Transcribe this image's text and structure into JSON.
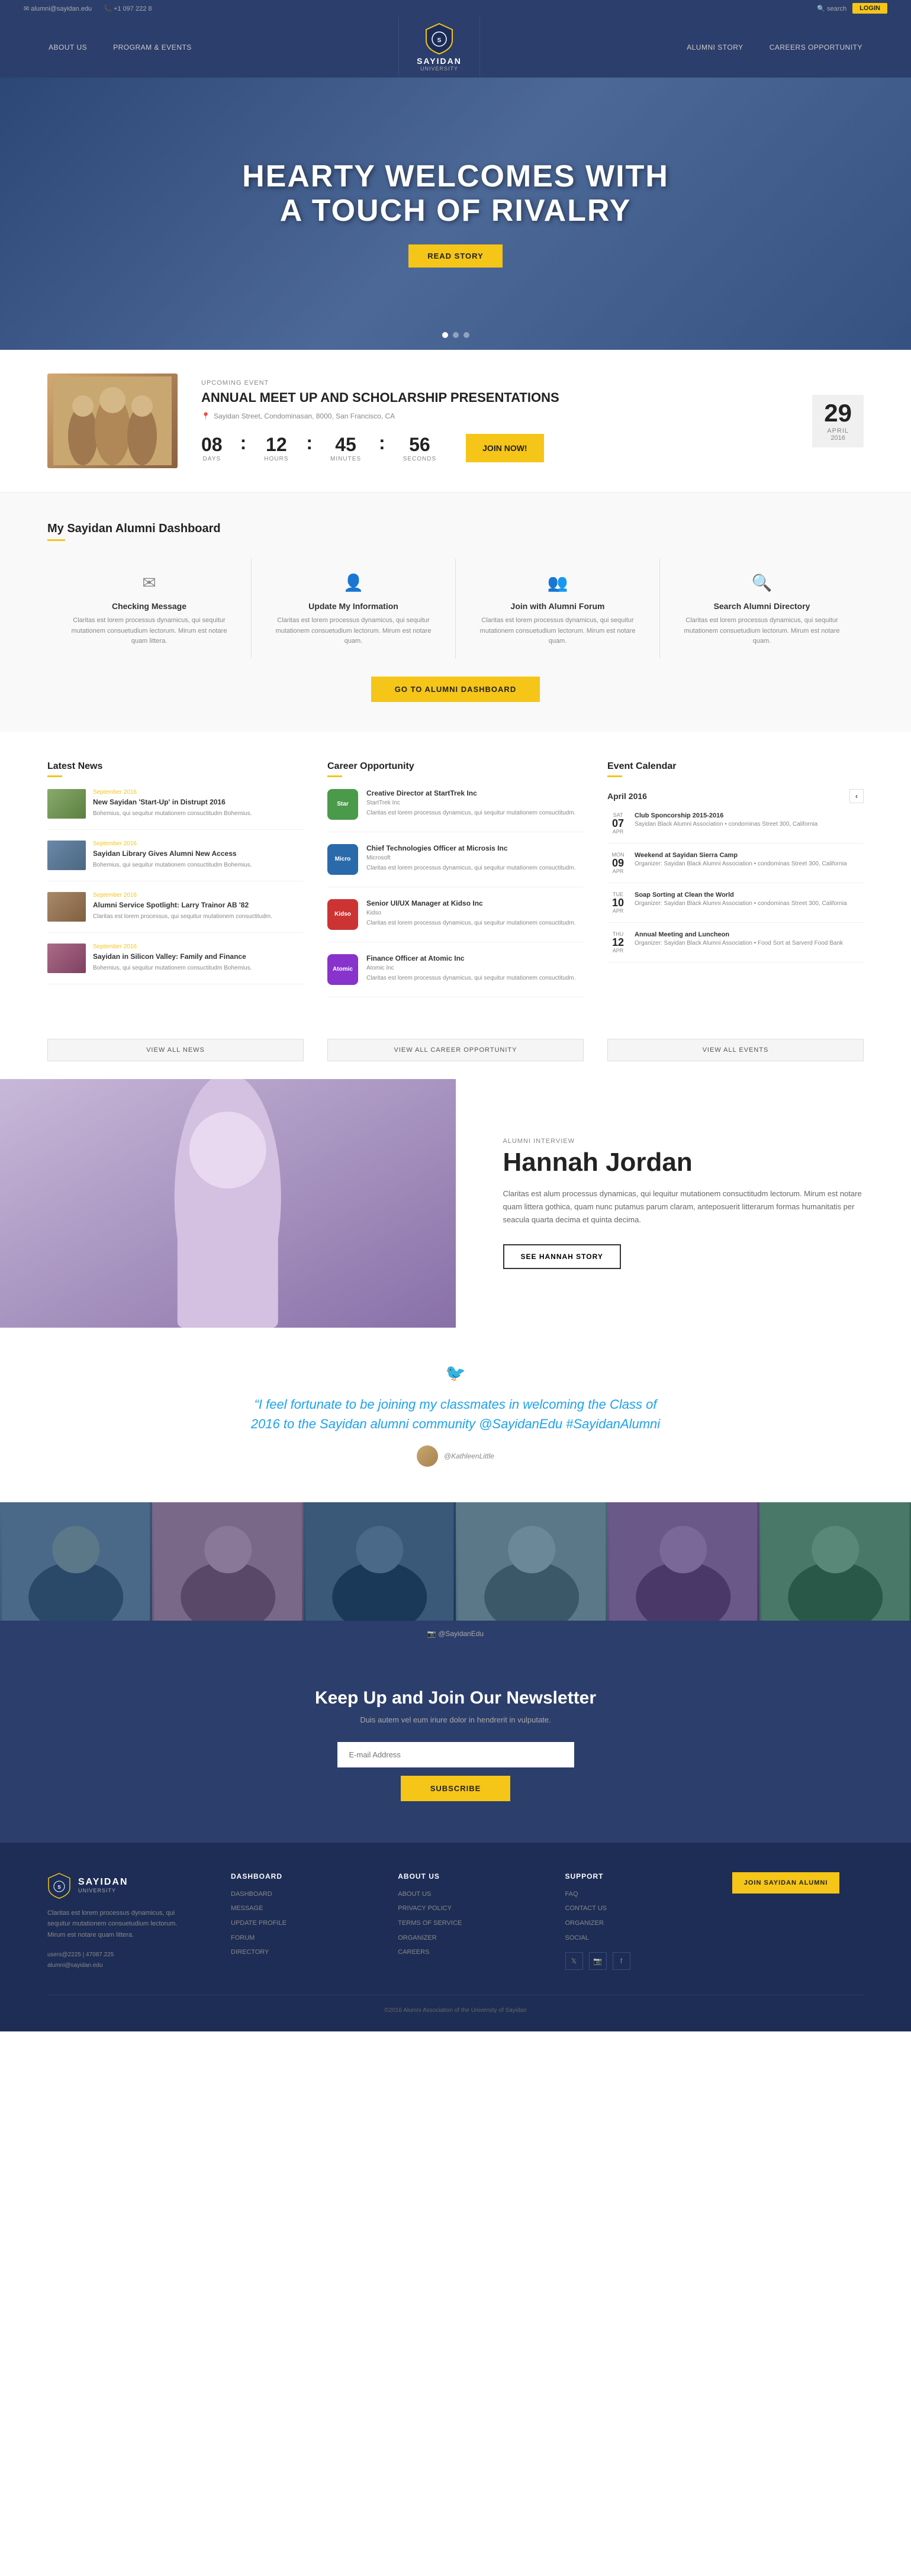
{
  "topbar": {
    "email": "alumni@sayidan.edu",
    "phone": "+1 097 222 8",
    "search_placeholder": "search",
    "login_label": "LOGIN"
  },
  "nav": {
    "links": [
      {
        "label": "ABOUT US",
        "id": "about"
      },
      {
        "label": "PROGRAM & EVENTS",
        "id": "programs"
      },
      {
        "label": "ALUMNI STORY",
        "id": "alumni-story"
      },
      {
        "label": "CAREERS OPPORTUNITY",
        "id": "careers"
      }
    ],
    "logo": {
      "name": "SAYIDAN",
      "sub": "UNIVERSITY"
    }
  },
  "hero": {
    "headline_line1": "HEARTY WELCOMES WITH",
    "headline_line2": "A TOUCH OF RIVALRY",
    "cta_label": "READ STORY"
  },
  "event": {
    "label": "UPCOMING EVENT",
    "title": "ANNUAL MEET UP AND SCHOLARSHIP PRESENTATIONS",
    "location": "Sayidan Street, Condominasan, 8000, San Francisco, CA",
    "date_day": "29",
    "date_month": "APRIL",
    "date_year": "2016",
    "countdown": {
      "days": "08",
      "hours": "12",
      "minutes": "45",
      "seconds": "56"
    },
    "cta_label": "Join Now!"
  },
  "dashboard": {
    "title": "My Sayidan Alumni Dashboard",
    "cards": [
      {
        "id": "checking-message",
        "icon": "✉",
        "title": "Checking Message",
        "text": "Claritas est lorem processus dynamicus, qui sequitur mutationem consuetudium lectorum. Mirum est notare quam littera."
      },
      {
        "id": "update-information",
        "icon": "👤",
        "title": "Update My Information",
        "text": "Claritas est lorem processus dynamicus, qui sequitur mutationem consuetudium lectorum. Mirum est notare quam."
      },
      {
        "id": "join-alumni-forum",
        "icon": "👥",
        "title": "Join with Alumni Forum",
        "text": "Claritas est lorem processus dynamicus, qui sequitur mutationem consuetudium lectorum. Mirum est notare quam."
      },
      {
        "id": "search-directory",
        "icon": "🔍",
        "title": "Search Alumni Directory",
        "text": "Claritas est lorem processus dynamicus, qui sequitur mutationem consuetudium lectorum. Mirum est notare quam."
      }
    ],
    "btn_label": "GO TO ALUMNI DASHBOARD"
  },
  "news": {
    "section_title": "Latest News",
    "items": [
      {
        "title": "New Sayidan 'Start-Up' in Distrupt 2016",
        "date": "September 2016",
        "text": "Bohemius, qui sequitur mutationem consuctitudm Bohemius."
      },
      {
        "title": "Sayidan Library Gives Alumni New Access",
        "date": "September 2016",
        "text": "Bohemius, qui sequitur mutationem consuctitudm Bohemius."
      },
      {
        "title": "Alumni Service Spotlight: Larry Trainor AB '82",
        "date": "September 2016",
        "text": "Claritas est lorem processus, qui sequitur mutationem consuctitudm."
      },
      {
        "title": "Sayidan in Silicon Valley: Family and Finance",
        "date": "September 2016",
        "text": "Bohemius, qui sequitur mutationem consuctitudm Bohemius."
      }
    ],
    "view_all": "View All News"
  },
  "careers": {
    "section_title": "Career Opportunity",
    "items": [
      {
        "company": "StartTrek Inc",
        "color": "#4a9a4a",
        "abbr": "Star",
        "title": "Creative Director at StartTrek Inc",
        "text": "Claritas est lorem processus dynamicus, qui sequitur mutationem consuctitudm."
      },
      {
        "company": "Microsoft",
        "color": "#2a6aaa",
        "abbr": "Micro",
        "title": "Chief Technologies Officer at Microsis Inc",
        "text": "Claritas est lorem processus dynamicus, qui sequitur mutationem consuctitudm."
      },
      {
        "company": "Kidso",
        "color": "#cc3333",
        "abbr": "Kidso",
        "title": "Senior UI/UX Manager at Kidso Inc",
        "text": "Claritas est lorem processus dynamicus, qui sequitur mutationem consuctitudm."
      },
      {
        "company": "Atomic Inc",
        "color": "#8833cc",
        "abbr": "Atomic",
        "title": "Finance Officer at Atomic Inc",
        "text": "Claritas est lorem processus dynamicus, qui sequitur mutationem consuctitudm."
      }
    ],
    "view_all": "View All Career Opportunity"
  },
  "calendar": {
    "section_title": "Event Calendar",
    "month": "April 2016",
    "events": [
      {
        "day_label": "SAT",
        "day_num": "07",
        "day_abr": "APR",
        "title": "Club Sponcorship 2015-2016",
        "detail": "Sayidan Black Alumni Association • condominas Street 300, California"
      },
      {
        "day_label": "MON",
        "day_num": "09",
        "day_abr": "APR",
        "title": "Weekend at Sayidan Sierra Camp",
        "detail": "Organizer: Sayidan Black Alumni Association • condominas Street 300, California"
      },
      {
        "day_label": "TUE",
        "day_num": "10",
        "day_abr": "APR",
        "title": "Soap Sorting at Clean the World",
        "detail": "Organizer: Sayidan Black Alumni Association • condominas Street 300, California"
      },
      {
        "day_label": "THU",
        "day_num": "12",
        "day_abr": "APR",
        "title": "Annual Meeting and Luncheon",
        "detail": "Organizer: Sayidan Black Alumni Association • Food Sort at Sarverd Food Bank"
      }
    ],
    "view_all": "View All Events"
  },
  "alumni_interview": {
    "label": "Alumni Interview",
    "name": "Hannah Jordan",
    "quote": "Claritas est alum processus dynamicas, qui lequitur mutationem consuctitudm lectorum. Mirum est notare quam littera gothica, quam nunc putamus parum claram, anteposuerit litterarum formas humanitatis per seacula quarta decima et quinta decima.",
    "cta_label": "SEE HANNAH STORY"
  },
  "twitter": {
    "quote": "“I feel fortunate to be joining my classmates in welcoming the Class of 2016 to the Sayidan alumni community",
    "hashtags": "@SayidanEdu #SayidanAlumni",
    "username": "@KathleenLittle"
  },
  "instagram": {
    "handle": "@SayidanEdu"
  },
  "newsletter": {
    "title": "Keep Up and Join Our Newsletter",
    "subtitle": "Duis autem vel eum iriure dolor in hendrerit in vulputate.",
    "input_placeholder": "E-mail Address",
    "btn_label": "SUBSCRIBE"
  },
  "footer": {
    "logo_name": "SAYIDAN",
    "logo_sub": "alumni UNIVERSITY",
    "description": "Claritas est lorem processus dynamicus, qui sequitur mutationem consuetudium lectorum. Mirum est notare quam littera.",
    "contact_line1": "users@2225 | 47087.225",
    "contact_line2": "alumni@sayidan.edu",
    "columns": [
      {
        "title": "DASHBOARD",
        "links": [
          "DASHBOARD",
          "MESSAGE",
          "UPDATE PROFILE",
          "FORUM",
          "DIRECTORY"
        ]
      },
      {
        "title": "ABOUT US",
        "links": [
          "ABOUT US",
          "PRIVACY POLICY",
          "TERMS OF SERVICE",
          "ORGANIZER",
          "CAREERS"
        ]
      },
      {
        "title": "SUPPORT",
        "links": [
          "FAQ",
          "CONTACT US",
          "ORGANIZER",
          "SOCIAL"
        ]
      }
    ],
    "copyright": "©2016 Alumni Association of the University of Sayidan"
  }
}
